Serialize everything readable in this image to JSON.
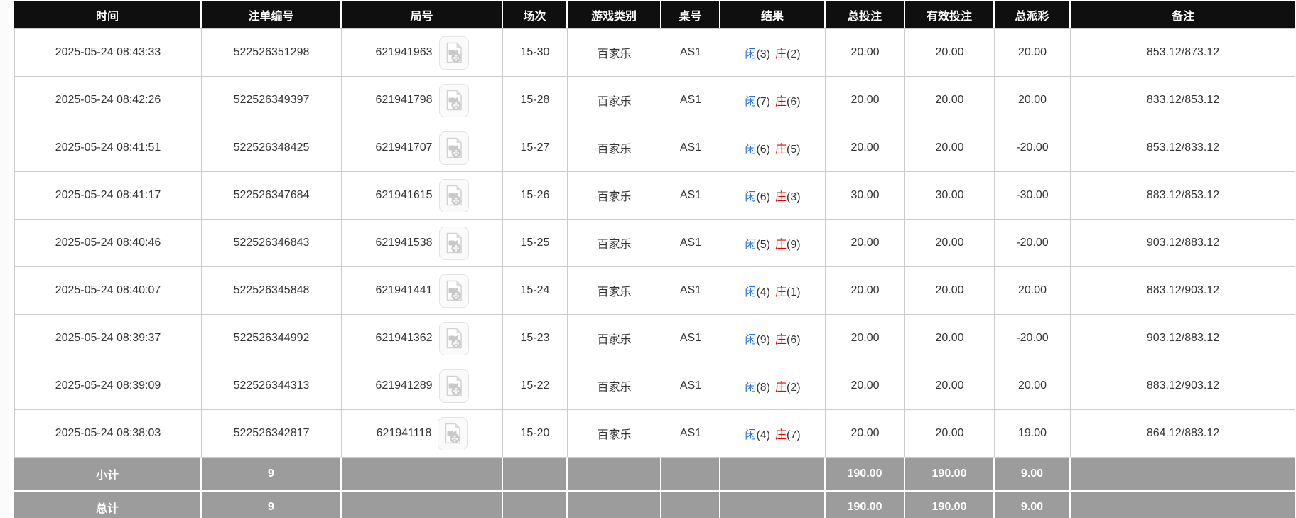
{
  "table": {
    "columns": [
      {
        "key": "time",
        "label": "时间"
      },
      {
        "key": "bet_id",
        "label": "注单编号"
      },
      {
        "key": "round_id",
        "label": "局号"
      },
      {
        "key": "session",
        "label": "场次"
      },
      {
        "key": "game_type",
        "label": "游戏类别"
      },
      {
        "key": "table_no",
        "label": "桌号"
      },
      {
        "key": "result",
        "label": "结果"
      },
      {
        "key": "total_bet",
        "label": "总投注"
      },
      {
        "key": "valid_bet",
        "label": "有效投注"
      },
      {
        "key": "payout",
        "label": "总派彩"
      },
      {
        "key": "remark",
        "label": "备注"
      }
    ],
    "rows": [
      {
        "time": "2025-05-24 08:43:33",
        "bet_id": "522526351298",
        "round_id": "621941963",
        "session": "15-30",
        "game_type": "百家乐",
        "table_no": "AS1",
        "player_label": "闲",
        "player_score": "(3)",
        "banker_label": "庄",
        "banker_score": "(2)",
        "total_bet": "20.00",
        "valid_bet": "20.00",
        "payout": "20.00",
        "remark": "853.12/873.12"
      },
      {
        "time": "2025-05-24 08:42:26",
        "bet_id": "522526349397",
        "round_id": "621941798",
        "session": "15-28",
        "game_type": "百家乐",
        "table_no": "AS1",
        "player_label": "闲",
        "player_score": "(7)",
        "banker_label": "庄",
        "banker_score": "(6)",
        "total_bet": "20.00",
        "valid_bet": "20.00",
        "payout": "20.00",
        "remark": "833.12/853.12"
      },
      {
        "time": "2025-05-24 08:41:51",
        "bet_id": "522526348425",
        "round_id": "621941707",
        "session": "15-27",
        "game_type": "百家乐",
        "table_no": "AS1",
        "player_label": "闲",
        "player_score": "(6)",
        "banker_label": "庄",
        "banker_score": "(5)",
        "total_bet": "20.00",
        "valid_bet": "20.00",
        "payout": "-20.00",
        "remark": "853.12/833.12"
      },
      {
        "time": "2025-05-24 08:41:17",
        "bet_id": "522526347684",
        "round_id": "621941615",
        "session": "15-26",
        "game_type": "百家乐",
        "table_no": "AS1",
        "player_label": "闲",
        "player_score": "(6)",
        "banker_label": "庄",
        "banker_score": "(3)",
        "total_bet": "30.00",
        "valid_bet": "30.00",
        "payout": "-30.00",
        "remark": "883.12/853.12"
      },
      {
        "time": "2025-05-24 08:40:46",
        "bet_id": "522526346843",
        "round_id": "621941538",
        "session": "15-25",
        "game_type": "百家乐",
        "table_no": "AS1",
        "player_label": "闲",
        "player_score": "(5)",
        "banker_label": "庄",
        "banker_score": "(9)",
        "total_bet": "20.00",
        "valid_bet": "20.00",
        "payout": "-20.00",
        "remark": "903.12/883.12"
      },
      {
        "time": "2025-05-24 08:40:07",
        "bet_id": "522526345848",
        "round_id": "621941441",
        "session": "15-24",
        "game_type": "百家乐",
        "table_no": "AS1",
        "player_label": "闲",
        "player_score": "(4)",
        "banker_label": "庄",
        "banker_score": "(1)",
        "total_bet": "20.00",
        "valid_bet": "20.00",
        "payout": "20.00",
        "remark": "883.12/903.12"
      },
      {
        "time": "2025-05-24 08:39:37",
        "bet_id": "522526344992",
        "round_id": "621941362",
        "session": "15-23",
        "game_type": "百家乐",
        "table_no": "AS1",
        "player_label": "闲",
        "player_score": "(9)",
        "banker_label": "庄",
        "banker_score": "(6)",
        "total_bet": "20.00",
        "valid_bet": "20.00",
        "payout": "-20.00",
        "remark": "903.12/883.12"
      },
      {
        "time": "2025-05-24 08:39:09",
        "bet_id": "522526344313",
        "round_id": "621941289",
        "session": "15-22",
        "game_type": "百家乐",
        "table_no": "AS1",
        "player_label": "闲",
        "player_score": "(8)",
        "banker_label": "庄",
        "banker_score": "(2)",
        "total_bet": "20.00",
        "valid_bet": "20.00",
        "payout": "20.00",
        "remark": "883.12/903.12"
      },
      {
        "time": "2025-05-24 08:38:03",
        "bet_id": "522526342817",
        "round_id": "621941118",
        "session": "15-20",
        "game_type": "百家乐",
        "table_no": "AS1",
        "player_label": "闲",
        "player_score": "(4)",
        "banker_label": "庄",
        "banker_score": "(7)",
        "total_bet": "20.00",
        "valid_bet": "20.00",
        "payout": "19.00",
        "remark": "864.12/883.12"
      }
    ],
    "subtotal": {
      "label": "小计",
      "count": "9",
      "total_bet": "190.00",
      "valid_bet": "190.00",
      "payout": "9.00"
    },
    "grand_total": {
      "label": "总计",
      "count": "9",
      "total_bet": "190.00",
      "valid_bet": "190.00",
      "payout": "9.00"
    }
  },
  "icons": {
    "round_video": "video-replay-icon"
  },
  "colors": {
    "header_bg": "#0f0f0f",
    "header_text": "#ffffff",
    "row_border": "#cccccc",
    "summary_bg": "#9c9c9c",
    "player_blue": "#2a6fdb",
    "banker_red": "#e60000",
    "bet_blue": "#2a6fdb",
    "negative_red": "#e60000",
    "text": "#333333"
  }
}
